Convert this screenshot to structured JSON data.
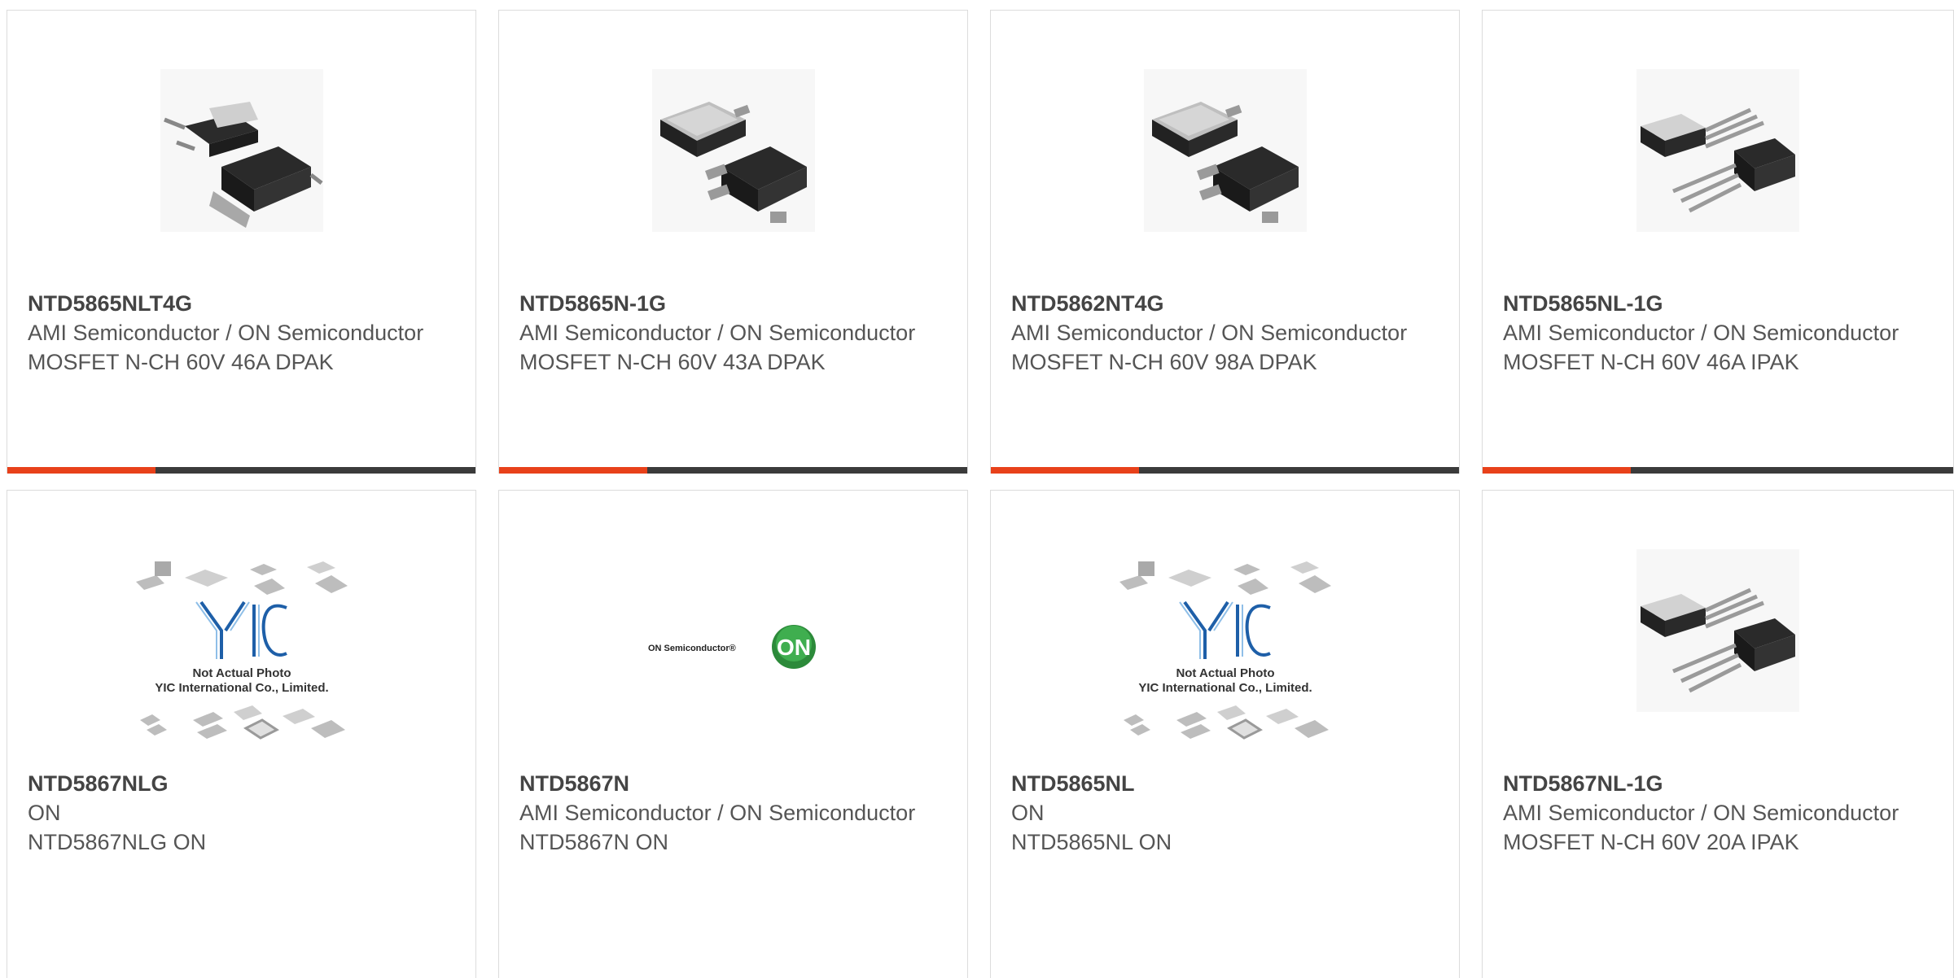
{
  "colors": {
    "accent": "#e8411a",
    "bar": "#3b3b3b",
    "text": "#555555",
    "border": "#dcdcdc"
  },
  "products": [
    {
      "part_number": "NTD5865NLT4G",
      "manufacturer": "AMI Semiconductor / ON Semiconductor",
      "description": "MOSFET N-CH 60V 46A DPAK",
      "image": "dpak-package-image"
    },
    {
      "part_number": "NTD5865N-1G",
      "manufacturer": "AMI Semiconductor / ON Semiconductor",
      "description": "MOSFET N-CH 60V 43A DPAK",
      "image": "dpak-package-image"
    },
    {
      "part_number": "NTD5862NT4G",
      "manufacturer": "AMI Semiconductor / ON Semiconductor",
      "description": "MOSFET N-CH 60V 98A DPAK",
      "image": "dpak-package-image"
    },
    {
      "part_number": "NTD5865NL-1G",
      "manufacturer": "AMI Semiconductor / ON Semiconductor",
      "description": "MOSFET N-CH 60V 46A IPAK",
      "image": "ipak-package-image"
    },
    {
      "part_number": "NTD5867NLG",
      "manufacturer": "ON",
      "description": "NTD5867NLG ON",
      "image": "not-actual-photo-image",
      "placeholder_text": [
        "Not Actual Photo",
        "YIC International Co., Limited."
      ]
    },
    {
      "part_number": "NTD5867N",
      "manufacturer": "AMI Semiconductor / ON Semiconductor",
      "description": "NTD5867N ON",
      "image": "on-semiconductor-logo",
      "logo_text": "ON Semiconductor®",
      "logo_badge": "ON"
    },
    {
      "part_number": "NTD5865NL",
      "manufacturer": "ON",
      "description": "NTD5865NL ON",
      "image": "not-actual-photo-image",
      "placeholder_text": [
        "Not Actual Photo",
        "YIC International Co., Limited."
      ]
    },
    {
      "part_number": "NTD5867NL-1G",
      "manufacturer": "AMI Semiconductor / ON Semiconductor",
      "description": "MOSFET N-CH 60V 20A IPAK",
      "image": "ipak-package-image"
    }
  ]
}
